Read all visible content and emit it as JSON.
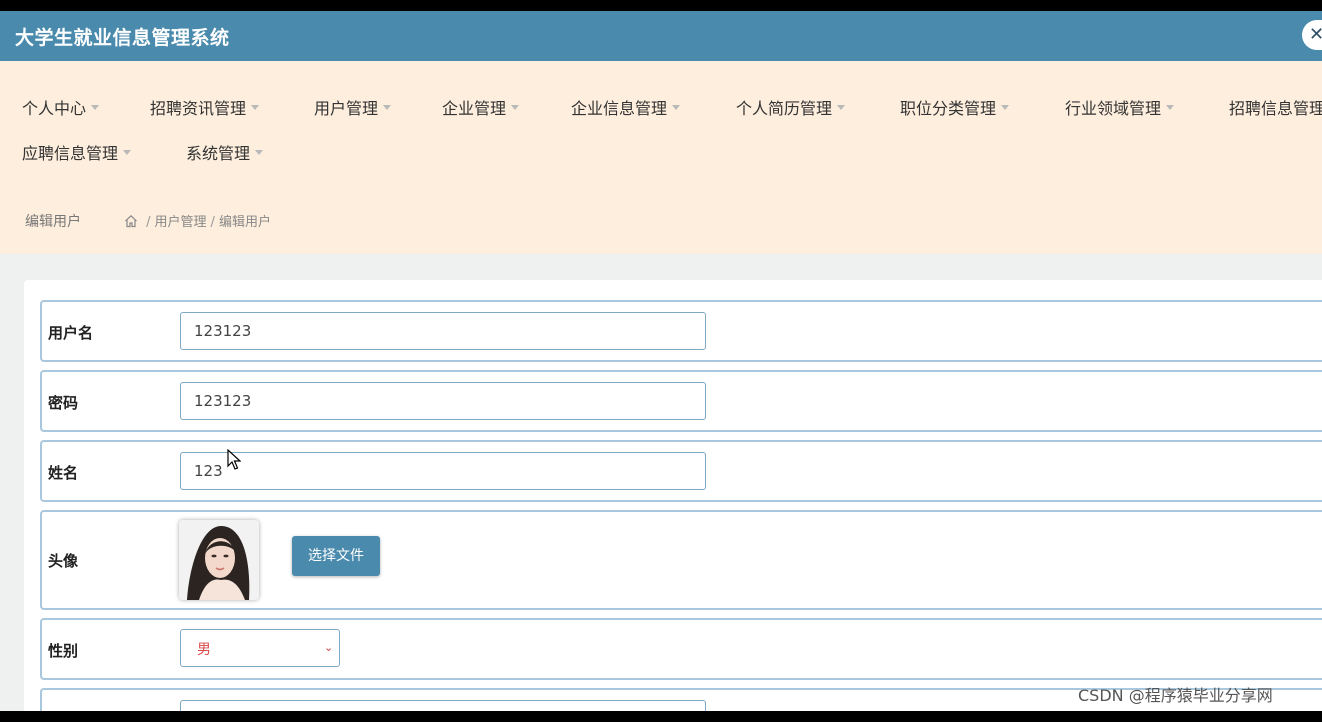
{
  "app": {
    "title": "大学生就业信息管理系统",
    "close_icon": "close-icon",
    "close_glyph": "✕"
  },
  "menu": [
    "个人中心",
    "招聘资讯管理",
    "用户管理",
    "企业管理",
    "企业信息管理",
    "个人简历管理",
    "职位分类管理",
    "行业领域管理",
    "招聘信息管理",
    "应聘信息管理",
    "系统管理"
  ],
  "breadcrumb": {
    "title": "编辑用户",
    "home_icon": "home-icon",
    "items": [
      "用户管理",
      "编辑用户"
    ],
    "separator": "/"
  },
  "form": {
    "username": {
      "label": "用户名",
      "value": "123123"
    },
    "password": {
      "label": "密码",
      "value": "123123"
    },
    "name": {
      "label": "姓名",
      "value": "123"
    },
    "avatar": {
      "label": "头像",
      "button": "选择文件"
    },
    "gender": {
      "label": "性别",
      "selected": "男"
    }
  },
  "watermark": "CSDN @程序猿毕业分享网",
  "colors": {
    "header": "#4a8bad",
    "nav_bg": "#fdeedd",
    "accent": "#4a8bad",
    "border": "#a9c8de"
  }
}
